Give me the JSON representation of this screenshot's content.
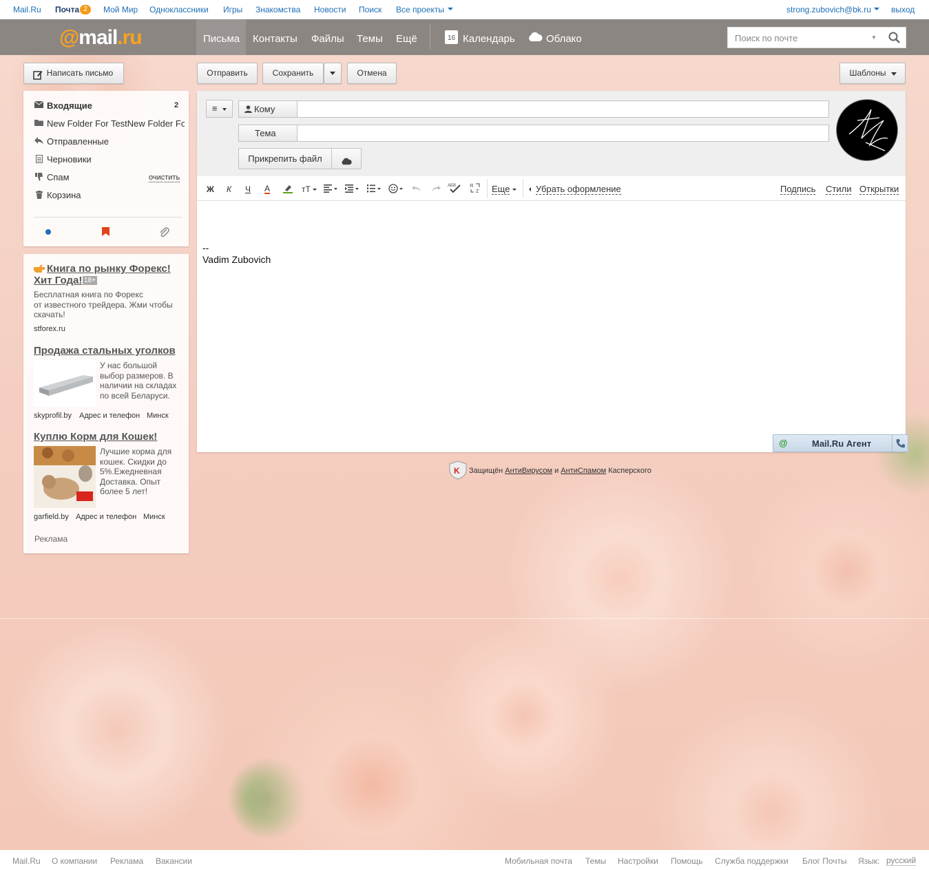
{
  "topbar": {
    "links": [
      "Mail.Ru",
      "Почта",
      "Мой Мир",
      "Одноклассники",
      "Игры",
      "Знакомства",
      "Новости",
      "Поиск",
      "Все проекты"
    ],
    "mail_badge": "2",
    "user_email": "strong.zubovich@bk.ru",
    "logout": "выход"
  },
  "header": {
    "logo_at": "@",
    "logo_mail": "mail",
    "logo_ru": ".ru",
    "nav": [
      "Письма",
      "Контакты",
      "Файлы",
      "Темы",
      "Ещё"
    ],
    "calendar_day": "16",
    "calendar": "Календарь",
    "cloud": "Облако",
    "search_placeholder": "Поиск по почте"
  },
  "actions": {
    "compose": "Написать письмо",
    "send": "Отправить",
    "save": "Сохранить",
    "cancel": "Отмена",
    "templates": "Шаблоны"
  },
  "folders": [
    {
      "label": "Входящие",
      "count": "2",
      "icon": "envelope-icon"
    },
    {
      "label": "New Folder For TestNew Folder For Test",
      "icon": "folder-icon"
    },
    {
      "label": "Отправленные",
      "icon": "reply-icon"
    },
    {
      "label": "Черновики",
      "icon": "draft-icon"
    },
    {
      "label": "Спам",
      "action": "очистить",
      "icon": "thumb-down-icon"
    },
    {
      "label": "Корзина",
      "icon": "trash-icon"
    }
  ],
  "ads": {
    "ad1": {
      "title_a": "Книга по рынку Форекс!",
      "title_b": "Хит Года!",
      "age": "18+",
      "text": [
        "Бесплатная книга по Форекс",
        "от известного трейдера. Жми чтобы",
        "скачать!"
      ],
      "domain": "stforex.ru"
    },
    "ad2": {
      "title": "Продажа стальных уголков",
      "text": [
        "У нас большой",
        "выбор размеров. В",
        "наличии на складах",
        "по всей Беларуси."
      ],
      "domain": "skyprofil.by",
      "address": "Адрес и телефон",
      "city": "Минск"
    },
    "ad3": {
      "title": "Куплю Корм для Кошек!",
      "text": [
        "Лучшие корма для",
        "кошек. Скидки до",
        "5%.Ежедневная",
        "Доставка. Опыт",
        "более 5 лет!"
      ],
      "domain": "garfield.by",
      "address": "Адрес и телефон",
      "city": "Минск"
    },
    "label": "Реклама"
  },
  "compose": {
    "to_label": "Кому",
    "subject_label": "Тема",
    "attach": "Прикрепить файл",
    "toolbar": {
      "bold": "Ж",
      "italic": "К",
      "underline": "Ч",
      "font_color": "A",
      "font_size": "тТ",
      "more": "Еще",
      "remove_format": "Убрать оформление",
      "signature": "Подпись",
      "styles": "Стили",
      "cards": "Открытки"
    },
    "body_sep": "--",
    "body_name": "Vadim Zubovich"
  },
  "agent": {
    "label": "Mail.Ru Агент"
  },
  "kaspersky": {
    "prefix": "Защищён",
    "av": "АнтиВирусом",
    "and": "и",
    "as": "АнтиСпамом",
    "suffix": "Касперского"
  },
  "footer": {
    "left": [
      "Mail.Ru",
      "О компании",
      "Реклама",
      "Вакансии"
    ],
    "right": [
      "Мобильная почта",
      "Темы",
      "Настройки",
      "Помощь",
      "Служба поддержки",
      "Блог Почты"
    ],
    "lang_label": "Язык:",
    "lang": "русский"
  },
  "colors": {
    "accent": "#f8a21d",
    "link": "#1d6eb6",
    "header_bg": "#4a403a"
  }
}
